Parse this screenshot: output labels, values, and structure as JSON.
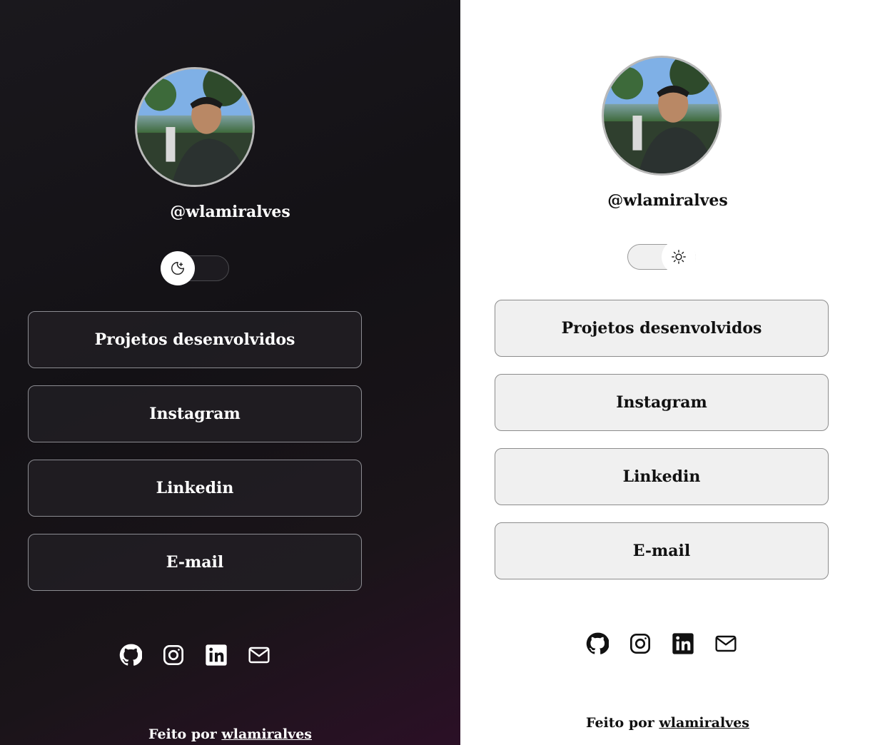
{
  "profile": {
    "username": "@wlamiralves"
  },
  "theme_toggle": {
    "dark_icon": "moon-stars-icon",
    "light_icon": "sun-icon"
  },
  "links": [
    {
      "label": "Projetos desenvolvidos"
    },
    {
      "label": "Instagram"
    },
    {
      "label": "Linkedin"
    },
    {
      "label": "E-mail"
    }
  ],
  "social_icons": [
    "github-icon",
    "instagram-icon",
    "linkedin-icon",
    "mail-icon"
  ],
  "footer": {
    "prefix": "Feito por",
    "author": "wlamiralves"
  },
  "colors": {
    "dark_bg": "#131115",
    "dark_gradient_accent": "#2b1026",
    "light_bg": "#ffffff",
    "light_button_bg": "#f0f0f0"
  }
}
